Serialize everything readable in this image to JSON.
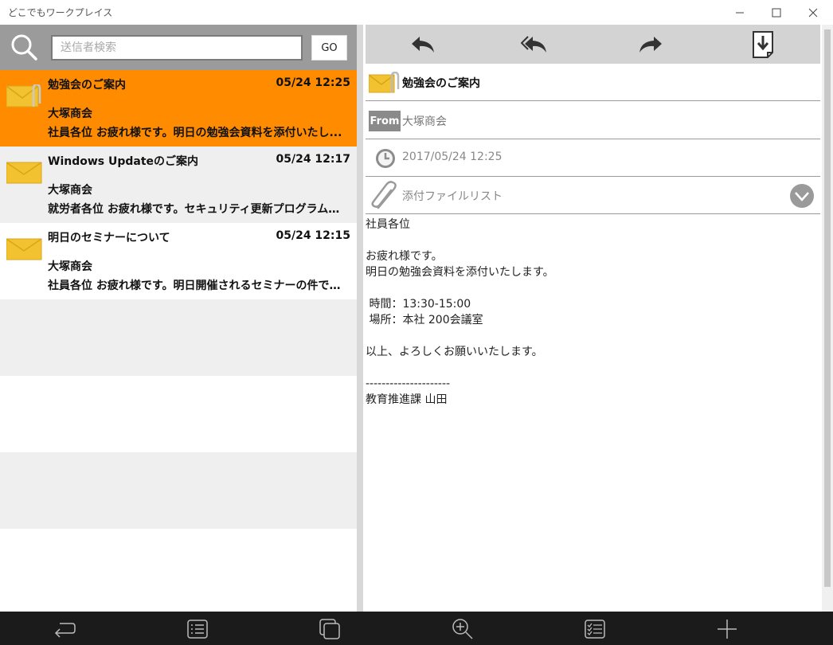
{
  "window": {
    "title": "どこでもワークプレイス"
  },
  "search": {
    "placeholder": "送信者検索",
    "value": "",
    "go_label": "GO"
  },
  "mails": [
    {
      "subject": "勉強会のご案内",
      "date": "05/24 12:25",
      "sender": "大塚商会",
      "preview": "社員各位 お疲れ様です。明日の勉強会資料を添付いたし...",
      "state": "selected",
      "attachment": true
    },
    {
      "subject": "Windows Updateのご案内",
      "date": "05/24 12:17",
      "sender": "大塚商会",
      "preview": "就労者各位 お疲れ様です。セキュリティ更新プログラムが公...",
      "state": "unread",
      "attachment": false
    },
    {
      "subject": "明日のセミナーについて",
      "date": "05/24 12:15",
      "sender": "大塚商会",
      "preview": "社員各位 お疲れ様です。明日開催されるセミナーの件です。",
      "state": "normal",
      "attachment": false
    }
  ],
  "reader": {
    "subject": "勉強会のご案内",
    "from_badge": "From",
    "from": "大塚商会",
    "datetime": "2017/05/24 12:25",
    "attachments_label": "添付ファイルリスト",
    "body": "社員各位\n\nお疲れ様です。\n明日の勉強会資料を添付いたします。\n\n 時間：13:30-15:00\n 場所：本社 200会議室\n\n以上、よろしくお願いいたします。\n\n---------------------\n教育推進課 山田"
  },
  "colors": {
    "selected": "#ff8c00",
    "toolbar": "#d3d3d3",
    "bottombar": "#1b1b1b",
    "envelope": "#f2c230"
  },
  "icons": {
    "toolbar": [
      "reply-icon",
      "reply-all-icon",
      "forward-icon",
      "download-icon"
    ],
    "bottombar": [
      "back-icon",
      "list-icon",
      "windows-icon",
      "zoom-icon",
      "checklist-icon",
      "add-icon"
    ]
  }
}
